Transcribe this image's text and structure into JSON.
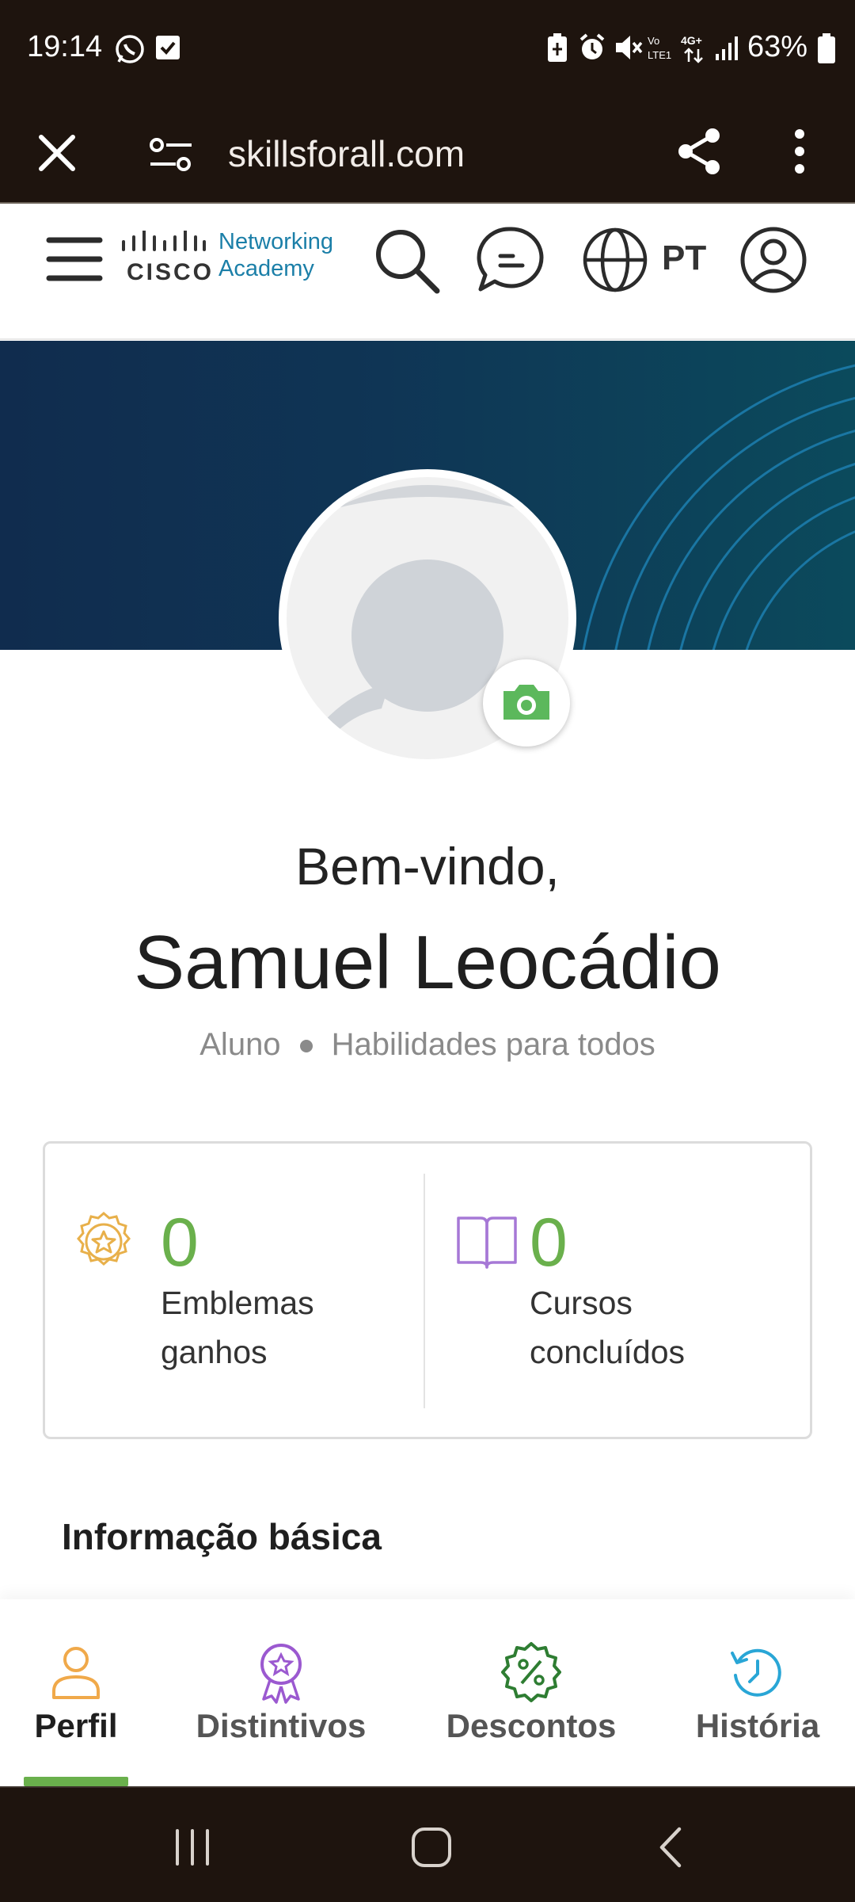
{
  "status_bar": {
    "time": "19:14",
    "battery": "63%",
    "icons": [
      "whatsapp-icon",
      "check-box-icon",
      "battery-saver-icon",
      "alarm-icon",
      "mute-icon",
      "volte-icon",
      "4g-icon",
      "signal-icon",
      "battery-icon"
    ]
  },
  "browser": {
    "url": "skillsforall.com",
    "icons": [
      "close-icon",
      "site-settings-icon",
      "share-icon",
      "more-vert-icon"
    ]
  },
  "site_header": {
    "logo_brand": "CISCO",
    "logo_line1": "Networking",
    "logo_line2": "Academy",
    "language": "PT",
    "icons": [
      "menu-icon",
      "search-icon",
      "chat-icon",
      "globe-icon",
      "account-icon"
    ]
  },
  "profile": {
    "welcome": "Bem-vindo,",
    "name": "Samuel Leocádio",
    "role": "Aluno",
    "program": "Habilidades para todos"
  },
  "stats": {
    "badges": {
      "value": "0",
      "label_line1": "Emblemas",
      "label_line2": "ganhos"
    },
    "courses": {
      "value": "0",
      "label_line1": "Cursos",
      "label_line2": "concluídos"
    }
  },
  "section_title": "Informação básica",
  "tabs": [
    {
      "label": "Perfil",
      "icon": "person-icon",
      "active": true
    },
    {
      "label": "Distintivos",
      "icon": "ribbon-badge-icon",
      "active": false
    },
    {
      "label": "Descontos",
      "icon": "discount-icon",
      "active": false
    },
    {
      "label": "História",
      "icon": "history-icon",
      "active": false
    }
  ],
  "colors": {
    "accent_green": "#6ab04c",
    "system_bar": "#1e140e",
    "banner_dark": "#102c4e",
    "banner_teal": "#0b4a5c",
    "link_blue": "#1b7fa8"
  }
}
